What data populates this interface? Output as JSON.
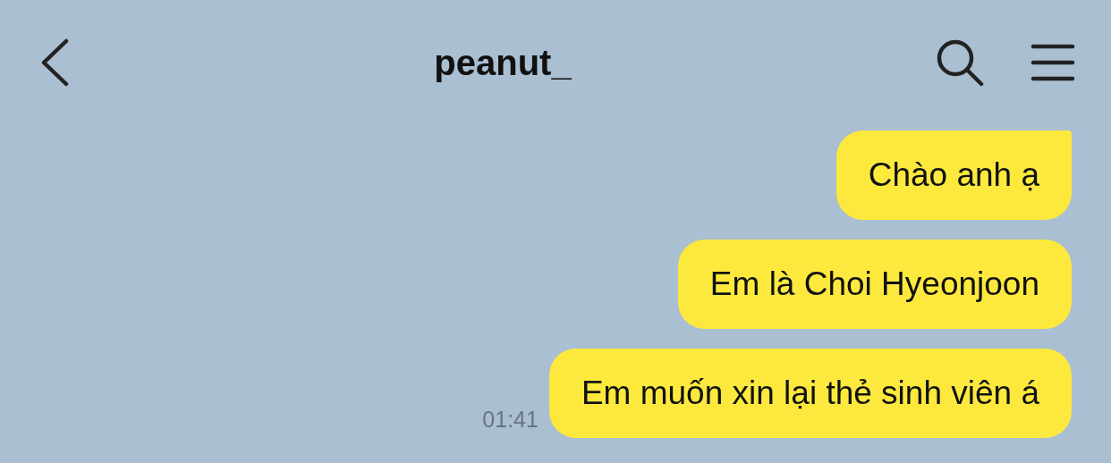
{
  "header": {
    "title": "peanut_"
  },
  "messages": [
    {
      "text": "Chào anh ạ",
      "tail": true
    },
    {
      "text": "Em là Choi Hyeonjoon",
      "tail": false
    },
    {
      "text": "Em muốn xin lại thẻ sinh viên á",
      "tail": false,
      "time": "01:41"
    }
  ]
}
